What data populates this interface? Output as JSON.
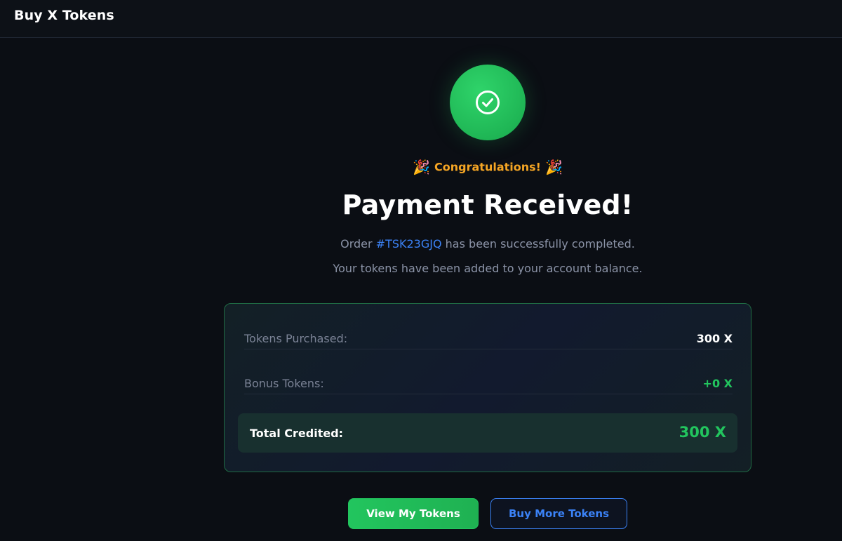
{
  "header": {
    "title": "Buy X Tokens"
  },
  "status": {
    "icon": "check-circle-icon",
    "congrats": "Congratulations!",
    "congrats_icon": "party-popper-icon",
    "heading": "Payment Received!",
    "order_prefix": "Order ",
    "order_id": "#TSK23GJQ",
    "order_suffix": " has been successfully completed.",
    "balance_message": "Your tokens have been added to your account balance."
  },
  "summary": {
    "tokens_label": "Tokens Purchased:",
    "tokens_value": "300 X",
    "bonus_label": "Bonus Tokens:",
    "bonus_value": "+0 X",
    "total_label": "Total Credited:",
    "total_value": "300 X"
  },
  "actions": {
    "view_tokens": "View My Tokens",
    "buy_more": "Buy More Tokens"
  },
  "colors": {
    "success": "#22c55e",
    "accent": "#3b82f6",
    "congrats": "#f5a524",
    "background": "#0b0e14"
  }
}
